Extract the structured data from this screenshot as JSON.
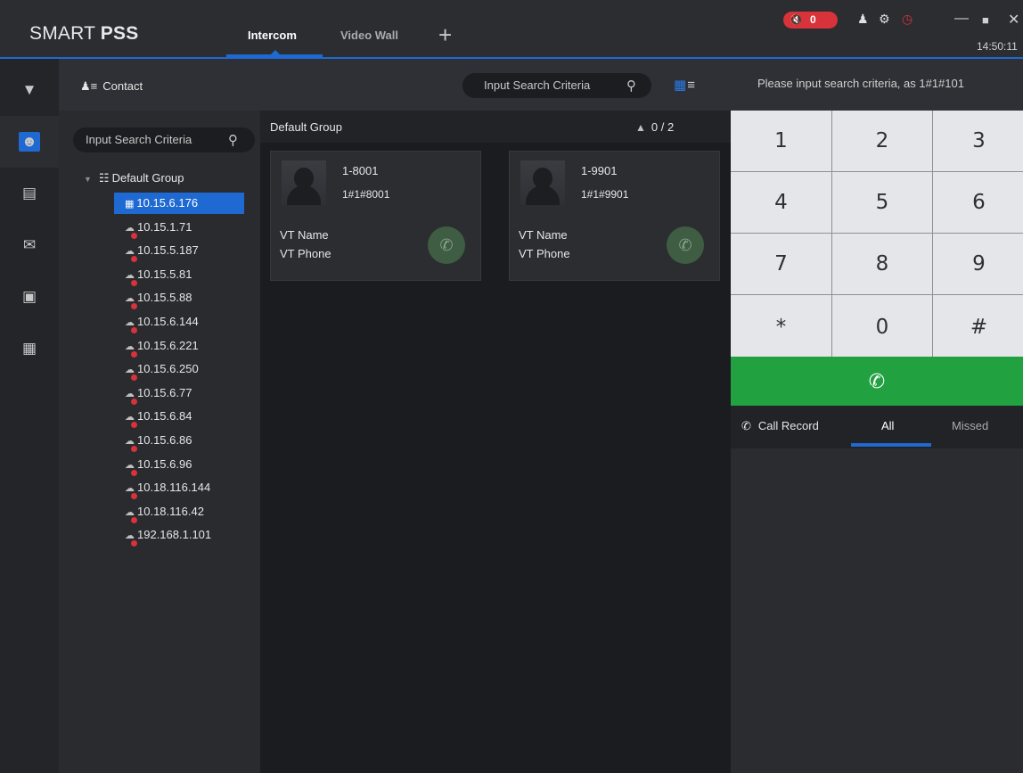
{
  "app": {
    "logo_light": "SMART ",
    "logo_bold": "PSS",
    "tabs": [
      {
        "label": "Intercom",
        "active": true
      },
      {
        "label": "Video Wall",
        "active": false
      }
    ],
    "add_tab_glyph": "+",
    "alarm_count": "0",
    "clock": "14:50:11",
    "accent_color": "#1e69d2",
    "alarm_color": "#d8323a"
  },
  "rail": {
    "items": [
      {
        "icon": "camera-icon",
        "active": false
      },
      {
        "icon": "contact-card-icon",
        "active": true
      },
      {
        "icon": "door-access-icon",
        "active": false
      },
      {
        "icon": "message-icon",
        "active": false
      },
      {
        "icon": "announcement-icon",
        "active": false
      },
      {
        "icon": "building-icon",
        "active": false
      }
    ]
  },
  "contacts": {
    "header_label": "Contact",
    "tree_search_placeholder": "Input Search Criteria",
    "root_label": "Default Group",
    "devices": [
      {
        "ip": "10.15.6.176",
        "selected": true,
        "online": true
      },
      {
        "ip": "10.15.1.71",
        "selected": false,
        "online": false
      },
      {
        "ip": "10.15.5.187",
        "selected": false,
        "online": false
      },
      {
        "ip": "10.15.5.81",
        "selected": false,
        "online": false
      },
      {
        "ip": "10.15.5.88",
        "selected": false,
        "online": false
      },
      {
        "ip": "10.15.6.144",
        "selected": false,
        "online": false
      },
      {
        "ip": "10.15.6.221",
        "selected": false,
        "online": false
      },
      {
        "ip": "10.15.6.250",
        "selected": false,
        "online": false
      },
      {
        "ip": "10.15.6.77",
        "selected": false,
        "online": false
      },
      {
        "ip": "10.15.6.84",
        "selected": false,
        "online": false
      },
      {
        "ip": "10.15.6.86",
        "selected": false,
        "online": false
      },
      {
        "ip": "10.15.6.96",
        "selected": false,
        "online": false
      },
      {
        "ip": "10.18.116.144",
        "selected": false,
        "online": false
      },
      {
        "ip": "10.18.116.42",
        "selected": false,
        "online": false
      },
      {
        "ip": "192.168.1.101",
        "selected": false,
        "online": false
      }
    ]
  },
  "center": {
    "search_placeholder": "Input Search Criteria",
    "group_title": "Default Group",
    "group_count": "0 / 2",
    "cards": [
      {
        "id": "1-8001",
        "address": "1#1#8001",
        "vt_name_label": "VT Name",
        "vt_phone_label": "VT Phone"
      },
      {
        "id": "1-9901",
        "address": "1#1#9901",
        "vt_name_label": "VT Name",
        "vt_phone_label": "VT Phone"
      }
    ]
  },
  "dialer": {
    "placeholder": "Please input search criteria, as 1#1#101",
    "keys": [
      "1",
      "2",
      "3",
      "4",
      "5",
      "6",
      "7",
      "8",
      "9",
      "*",
      "0",
      "#"
    ],
    "call_color": "#22a140",
    "record_label": "Call Record",
    "record_tabs": [
      {
        "label": "All",
        "active": true
      },
      {
        "label": "Missed",
        "active": false
      }
    ]
  }
}
